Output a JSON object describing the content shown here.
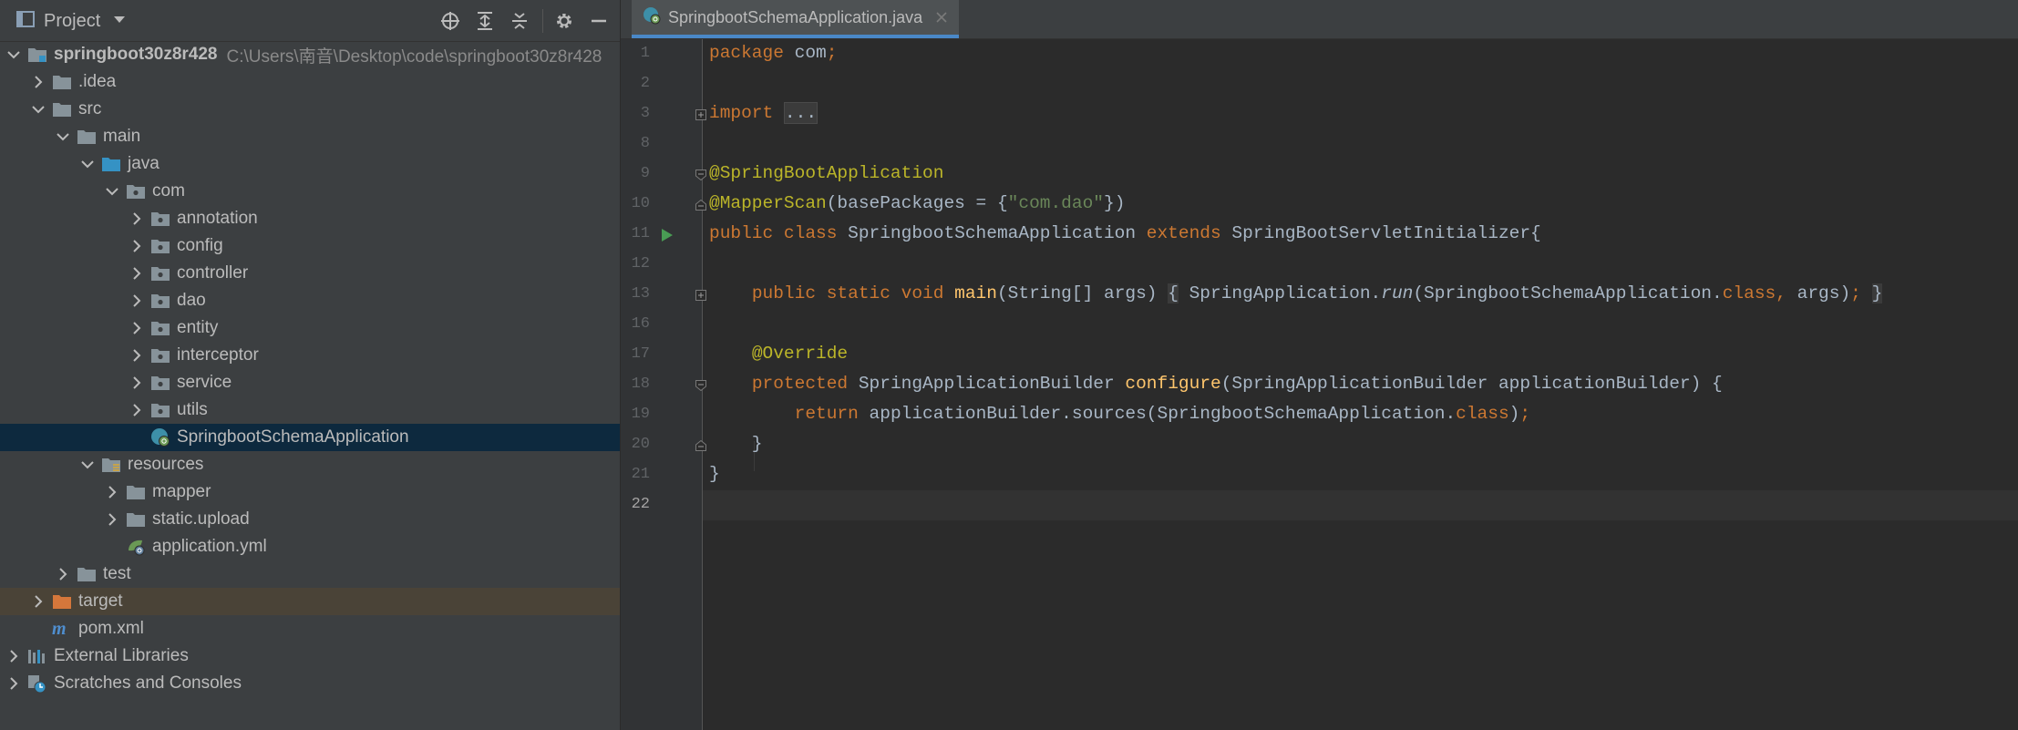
{
  "project_pane": {
    "title": "Project",
    "tools": [
      "locate-icon",
      "expand-all-icon",
      "collapse-all-icon",
      "gear-icon",
      "hide-icon"
    ]
  },
  "tree": [
    {
      "label": "springboot30z8r428",
      "path": "C:\\Users\\南音\\Desktop\\code\\springboot30z8r428",
      "depth": 0,
      "expanded": true,
      "icon": "module-folder"
    },
    {
      "label": ".idea",
      "depth": 1,
      "expanded": false,
      "icon": "folder"
    },
    {
      "label": "src",
      "depth": 1,
      "expanded": true,
      "icon": "folder"
    },
    {
      "label": "main",
      "depth": 2,
      "expanded": true,
      "icon": "folder"
    },
    {
      "label": "java",
      "depth": 3,
      "expanded": true,
      "icon": "source-folder"
    },
    {
      "label": "com",
      "depth": 4,
      "expanded": true,
      "icon": "package"
    },
    {
      "label": "annotation",
      "depth": 5,
      "expanded": false,
      "icon": "package"
    },
    {
      "label": "config",
      "depth": 5,
      "expanded": false,
      "icon": "package"
    },
    {
      "label": "controller",
      "depth": 5,
      "expanded": false,
      "icon": "package"
    },
    {
      "label": "dao",
      "depth": 5,
      "expanded": false,
      "icon": "package"
    },
    {
      "label": "entity",
      "depth": 5,
      "expanded": false,
      "icon": "package"
    },
    {
      "label": "interceptor",
      "depth": 5,
      "expanded": false,
      "icon": "package"
    },
    {
      "label": "service",
      "depth": 5,
      "expanded": false,
      "icon": "package"
    },
    {
      "label": "utils",
      "depth": 5,
      "expanded": false,
      "icon": "package"
    },
    {
      "label": "SpringbootSchemaApplication",
      "depth": 5,
      "expanded": null,
      "icon": "spring-class",
      "selected": true
    },
    {
      "label": "resources",
      "depth": 3,
      "expanded": true,
      "icon": "resources-folder"
    },
    {
      "label": "mapper",
      "depth": 4,
      "expanded": false,
      "icon": "folder"
    },
    {
      "label": "static.upload",
      "depth": 4,
      "expanded": false,
      "icon": "folder"
    },
    {
      "label": "application.yml",
      "depth": 4,
      "expanded": null,
      "icon": "yaml"
    },
    {
      "label": "test",
      "depth": 2,
      "expanded": false,
      "icon": "folder"
    },
    {
      "label": "target",
      "depth": 1,
      "expanded": false,
      "icon": "excluded-folder",
      "highlight": true
    },
    {
      "label": "pom.xml",
      "depth": 1,
      "expanded": null,
      "icon": "maven"
    },
    {
      "label": "External Libraries",
      "depth": 0,
      "expanded": false,
      "icon": "libraries"
    },
    {
      "label": "Scratches and Consoles",
      "depth": 0,
      "expanded": false,
      "icon": "scratches"
    }
  ],
  "editor": {
    "tab_label": "SpringbootSchemaApplication.java",
    "current_line": "22",
    "lines": [
      {
        "n": "1",
        "tokens": [
          [
            "kw",
            "package "
          ],
          [
            "",
            "com"
          ],
          [
            "kw",
            ";"
          ]
        ]
      },
      {
        "n": "2",
        "tokens": []
      },
      {
        "n": "3",
        "fold": "plus",
        "tokens": [
          [
            "kw",
            "import "
          ],
          [
            "folded",
            "..."
          ]
        ]
      },
      {
        "n": "8",
        "tokens": []
      },
      {
        "n": "9",
        "fold": "open",
        "tokens": [
          [
            "ann",
            "@SpringBootApplication"
          ]
        ]
      },
      {
        "n": "10",
        "fold": "close",
        "tokens": [
          [
            "ann",
            "@MapperScan"
          ],
          [
            "",
            "(basePackages = {"
          ],
          [
            "str",
            "\"com.dao\""
          ],
          [
            "",
            "})"
          ]
        ]
      },
      {
        "n": "11",
        "run": true,
        "tokens": [
          [
            "kw",
            "public class "
          ],
          [
            "",
            "SpringbootSchemaApplication "
          ],
          [
            "kw",
            "extends "
          ],
          [
            "",
            "SpringBootServletInitializer{"
          ]
        ]
      },
      {
        "n": "12",
        "tokens": []
      },
      {
        "n": "13",
        "fold": "plus",
        "tokens": [
          [
            "",
            "    "
          ],
          [
            "kw",
            "public static void "
          ],
          [
            "fn",
            "main"
          ],
          [
            "",
            "(String[] args) "
          ],
          [
            "brace",
            "{"
          ],
          [
            "",
            " SpringApplication."
          ],
          [
            "it",
            "run"
          ],
          [
            "",
            "(SpringbootSchemaApplication."
          ],
          [
            "kw",
            "class, "
          ],
          [
            "",
            "args)"
          ],
          [
            "kw",
            ";"
          ],
          [
            "",
            " "
          ],
          [
            "brace",
            "}"
          ]
        ]
      },
      {
        "n": "16",
        "tokens": []
      },
      {
        "n": "17",
        "tokens": [
          [
            "",
            "    "
          ],
          [
            "ann",
            "@Override"
          ]
        ]
      },
      {
        "n": "18",
        "fold": "open",
        "tokens": [
          [
            "",
            "    "
          ],
          [
            "kw",
            "protected "
          ],
          [
            "",
            "SpringApplicationBuilder "
          ],
          [
            "fn",
            "configure"
          ],
          [
            "",
            "(SpringApplicationBuilder applicationBuilder) {"
          ]
        ]
      },
      {
        "n": "19",
        "tokens": [
          [
            "",
            "        "
          ],
          [
            "kw",
            "return "
          ],
          [
            "",
            "applicationBuilder.sources(SpringbootSchemaApplication."
          ],
          [
            "kw",
            "class"
          ],
          [
            "",
            ")"
          ],
          [
            "kw",
            ";"
          ]
        ]
      },
      {
        "n": "20",
        "fold": "close",
        "tokens": [
          [
            "",
            "    }"
          ]
        ]
      },
      {
        "n": "21",
        "tokens": [
          [
            "",
            "}"
          ]
        ]
      },
      {
        "n": "22",
        "tokens": []
      }
    ]
  },
  "colors": {
    "keyword": "#cc7832",
    "annotation": "#bbb529",
    "string": "#6a8759",
    "method": "#ffc66d",
    "plain": "#a9b7c6",
    "selection": "#0d293e",
    "tab_underline": "#4a88c7"
  }
}
